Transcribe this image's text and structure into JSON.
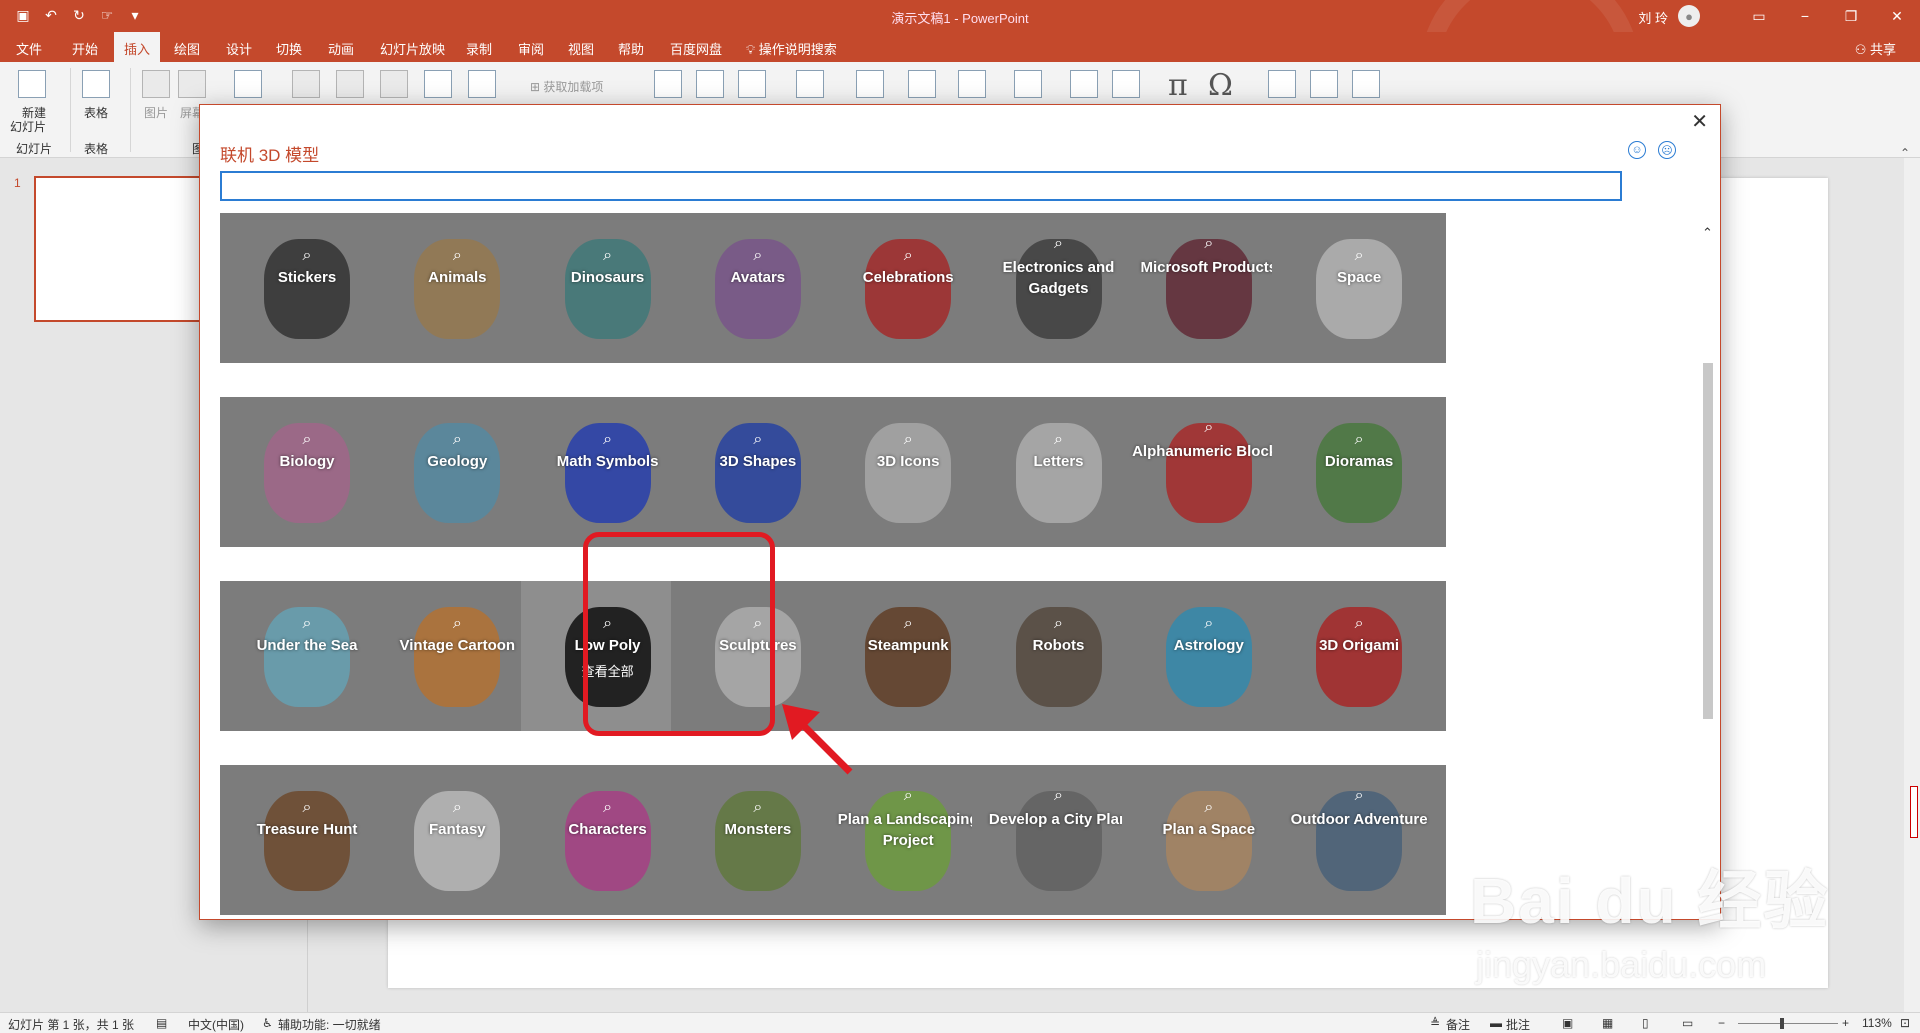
{
  "window": {
    "title": "演示文稿1 - PowerPoint",
    "user": "刘 玲"
  },
  "tabs": [
    "文件",
    "开始",
    "插入",
    "绘图",
    "设计",
    "切换",
    "动画",
    "幻灯片放映",
    "录制",
    "审阅",
    "视图",
    "帮助",
    "百度网盘"
  ],
  "active_tab": "插入",
  "tell_me": "操作说明搜索",
  "share": "共享",
  "ribbon": {
    "new_slide_line1": "新建",
    "new_slide_line2": "幻灯片",
    "group_slides": "幻灯片",
    "table": "表格",
    "group_tables": "表格",
    "pictures": "图片",
    "screenshot": "屏幕",
    "group_images": "图",
    "addins": "获取加载项"
  },
  "thumbnail": {
    "number": "1"
  },
  "dialog": {
    "title": "联机 3D 模型",
    "search_value": "",
    "happy_icon": "☺",
    "sad_icon": "☹",
    "close_icon": "✕",
    "view_all": "查看全部",
    "categories": [
      [
        "Stickers",
        "Animals",
        "Dinosaurs",
        "Avatars",
        "Celebrations",
        "Electronics and Gadgets",
        "Microsoft Products",
        "Space"
      ],
      [
        "Biology",
        "Geology",
        "Math Symbols",
        "3D Shapes",
        "3D Icons",
        "Letters",
        "Alphanumeric Blocks",
        "Dioramas"
      ],
      [
        "Under the Sea",
        "Vintage Cartoon",
        "Low Poly",
        "Sculptures",
        "Steampunk",
        "Robots",
        "Astrology",
        "3D Origami"
      ],
      [
        "Treasure Hunt",
        "Fantasy",
        "Characters",
        "Monsters",
        "Plan a Landscaping Project",
        "Develop a City Plan",
        "Plan a Space",
        "Outdoor Adventure"
      ]
    ],
    "hovered_category": "Low Poly"
  },
  "statusbar": {
    "slide_info": "幻灯片 第 1 张，共 1 张",
    "language": "中文(中国)",
    "accessibility": "辅助功能: 一切就绪",
    "notes": "备注",
    "comments": "批注",
    "zoom_minus": "−",
    "zoom_plus": "+",
    "zoom": "113%"
  },
  "watermark": {
    "line1": "Bai du 经验",
    "line2": "jingyan.baidu.com"
  },
  "colors": {
    "accent": "#c4492c",
    "highlight": "#e11a22",
    "focus": "#2b7cd3"
  }
}
